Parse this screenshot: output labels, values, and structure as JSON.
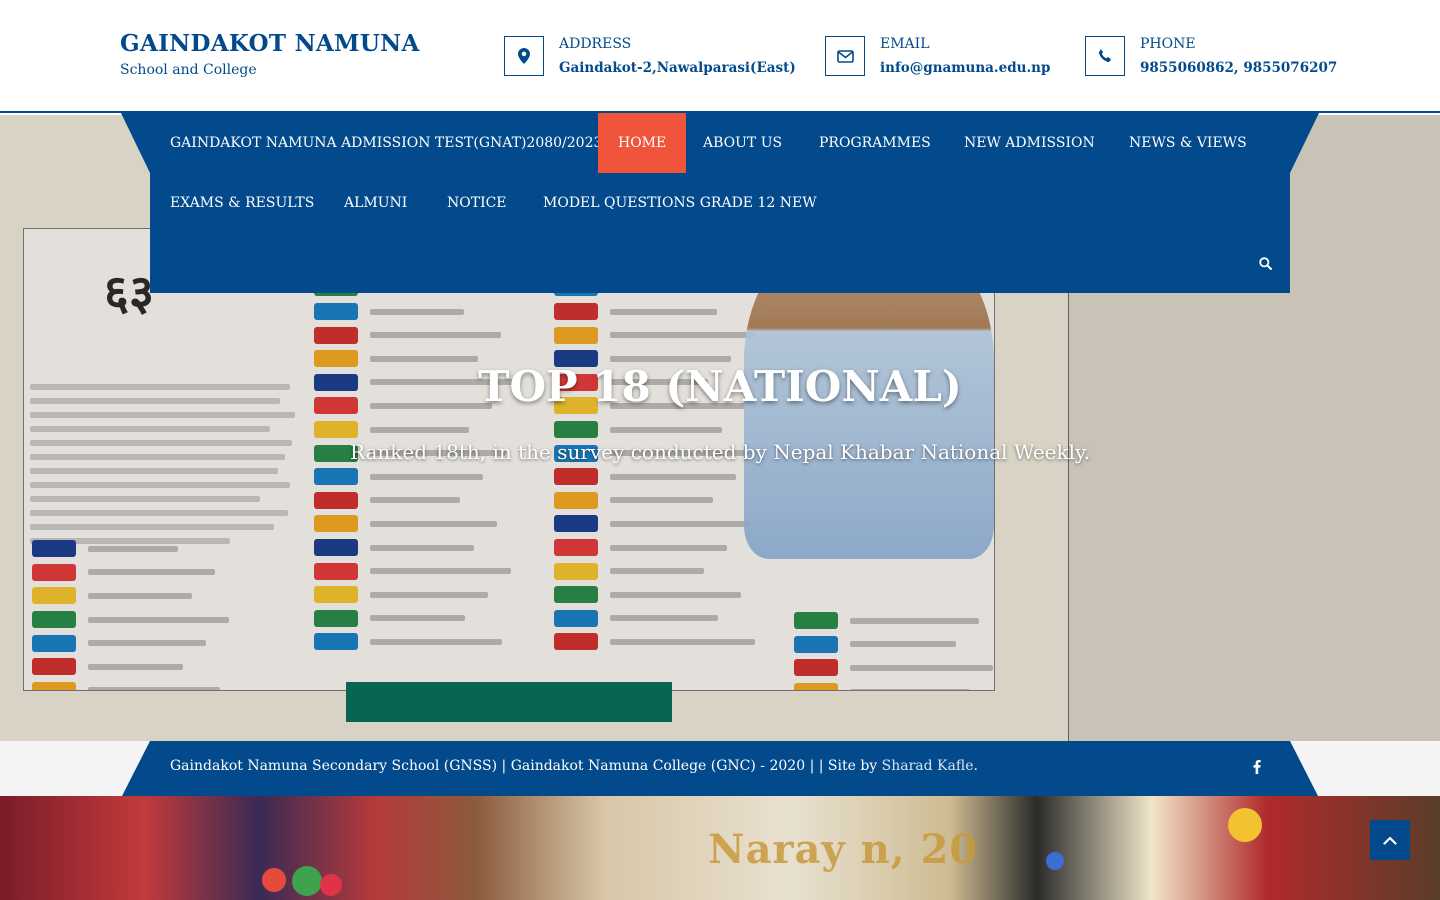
{
  "brand": {
    "title": "GAINDAKOT NAMUNA",
    "subtitle": "School and College"
  },
  "contacts": [
    {
      "label": "ADDRESS",
      "value": "Gaindakot-2,Nawalparasi(East)",
      "icon": "map-marker-icon"
    },
    {
      "label": "EMAIL",
      "value": "info@gnamuna.edu.np",
      "icon": "envelope-icon"
    },
    {
      "label": "PHONE",
      "value": "9855060862, 9855076207",
      "icon": "phone-icon"
    }
  ],
  "nav": {
    "items": [
      {
        "label": "GAINDAKOT NAMUNA ADMISSION TEST(GNAT)2080/2023",
        "active": false
      },
      {
        "label": "HOME",
        "active": true
      },
      {
        "label": "ABOUT US",
        "active": false
      },
      {
        "label": "PROGRAMMES",
        "active": false
      },
      {
        "label": "NEW ADMISSION",
        "active": false
      },
      {
        "label": "NEWS & VIEWS",
        "active": false
      },
      {
        "label": "EXAMS & RESULTS",
        "active": false
      },
      {
        "label": "ALMUNI",
        "active": false
      },
      {
        "label": "NOTICE",
        "active": false
      },
      {
        "label": "MODEL QUESTIONS GRADE 12 NEW",
        "active": false
      }
    ],
    "search_icon": "search-icon"
  },
  "hero": {
    "title": "TOP 18 (NATIONAL)",
    "subtitle": "Ranked 18th, in the survey conducted by Nepal Khabar National Weekly.",
    "poster_number": "६३"
  },
  "footer": {
    "text": "Gaindakot Namuna Secondary School (GNSS) | Gaindakot Namuna College (GNC) - 2020 | | Site by ",
    "link_text": "Sharad Kafle",
    "suffix": ".",
    "social_icon": "facebook-icon"
  },
  "photo_banner": {
    "text": "Naray            n, 20"
  },
  "colors": {
    "primary": "#034a8c",
    "accent": "#f0553c",
    "white": "#ffffff"
  }
}
